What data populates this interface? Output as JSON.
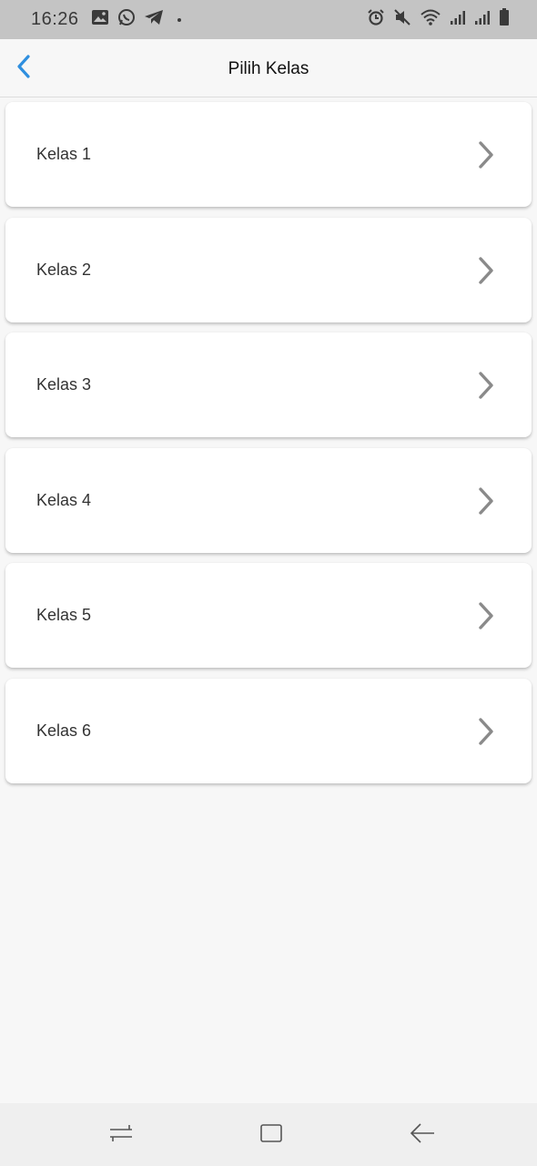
{
  "status_bar": {
    "time": "16:26",
    "left_icons": [
      "image-icon",
      "whatsapp-icon",
      "telegram-icon"
    ],
    "right_icons": [
      "alarm-icon",
      "mute-icon",
      "wifi-icon",
      "signal-icon",
      "signal-icon",
      "battery-icon"
    ]
  },
  "app_bar": {
    "title": "Pilih Kelas",
    "back_icon": "chevron-left-icon",
    "accent_color": "#2f8fdf"
  },
  "classes": [
    {
      "label": "Kelas 1"
    },
    {
      "label": "Kelas 2"
    },
    {
      "label": "Kelas 3"
    },
    {
      "label": "Kelas 4"
    },
    {
      "label": "Kelas 5"
    },
    {
      "label": "Kelas 6"
    }
  ],
  "nav_bar": {
    "buttons": [
      "recent-apps-icon",
      "home-icon",
      "back-arrow-icon"
    ]
  }
}
